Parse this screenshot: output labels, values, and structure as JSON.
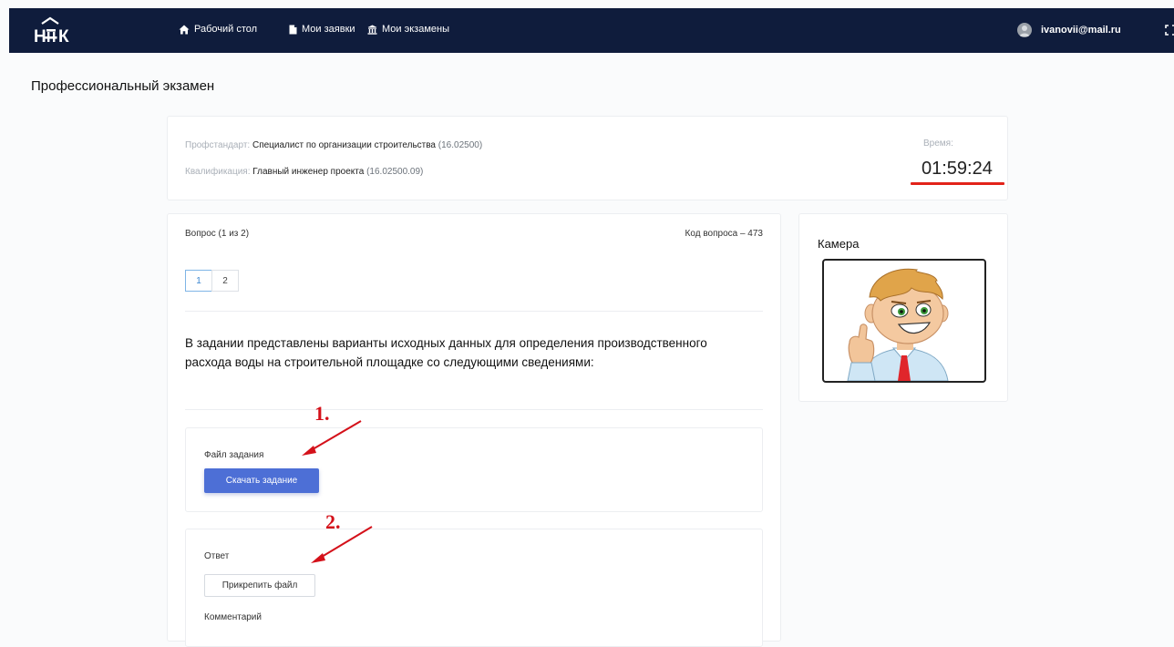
{
  "header": {
    "logo_text": "НПК",
    "nav": [
      {
        "label": "Рабочий стол",
        "icon": "home-icon"
      },
      {
        "label": "Мои заявки",
        "icon": "document-icon"
      },
      {
        "label": "Мои экзамены",
        "icon": "institution-icon"
      }
    ],
    "user_email": "ivanovii@mail.ru",
    "user_icon": "avatar-icon",
    "fullscreen_icon": "fullscreen-icon"
  },
  "page": {
    "title": "Профессиональный экзамен"
  },
  "exam_info": {
    "standard_label": "Профстандарт:",
    "standard_value": "Специалист по организации строительства",
    "standard_code": "(16.02500)",
    "qualification_label": "Квалификация:",
    "qualification_value": "Главный инженер проекта",
    "qualification_code": "(16.02500.09)",
    "time_label": "Время:",
    "time_value": "01:59:24"
  },
  "question": {
    "counter": "Вопрос (1 из 2)",
    "code": "Код вопроса – 473",
    "pages": [
      "1",
      "2"
    ],
    "active_page": "1",
    "text": "В задании представлены варианты исходных данных для определения производственного расхода воды на строительной площадке со следующими сведениями:"
  },
  "task_file": {
    "label": "Файл задания",
    "button": "Скачать задание"
  },
  "answer": {
    "label": "Ответ",
    "button": "Прикрепить файл",
    "comment_label": "Комментарий"
  },
  "camera": {
    "title": "Камера"
  },
  "annotations": {
    "step1": "1.",
    "step2": "2."
  },
  "colors": {
    "header_bg": "#0f1c3c",
    "primary_button": "#4d6fd6",
    "annotation_red": "#d4111a",
    "active_page": "#3a86d0"
  }
}
